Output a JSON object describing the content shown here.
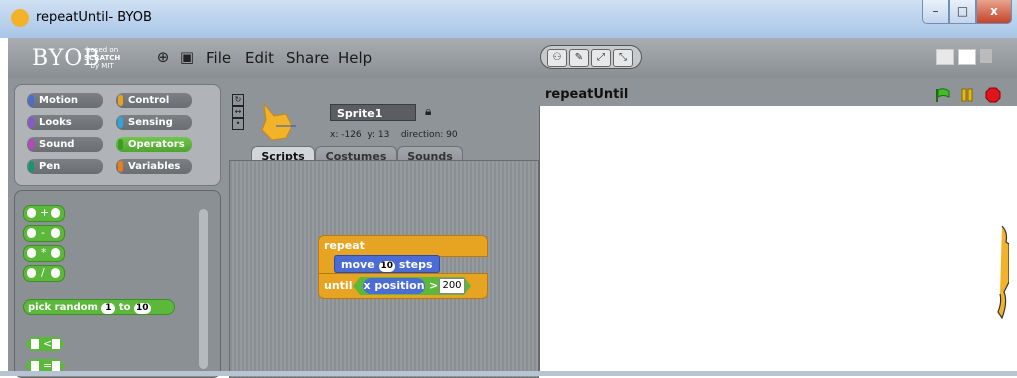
{
  "window": {
    "title": "repeatUntil- BYOB",
    "minimize_glyph": "–",
    "maximize_glyph": "□",
    "close_glyph": "x"
  },
  "menubar": {
    "logo": "BYOB",
    "logo_sub_line1": "based on",
    "logo_sub_line2": "SCRATCH",
    "logo_sub_line3": "by MIT",
    "language_icon": "globe-icon",
    "save_icon": "floppy-icon",
    "items": [
      "File",
      "Edit",
      "Share",
      "Help"
    ],
    "tools": [
      "person-icon",
      "wrench-icon",
      "grow-icon",
      "shrink-icon"
    ]
  },
  "categories": [
    {
      "label": "Motion",
      "color": "#4a6cd4"
    },
    {
      "label": "Control",
      "color": "#e6a422"
    },
    {
      "label": "Looks",
      "color": "#8a55d7"
    },
    {
      "label": "Sensing",
      "color": "#2ca5e2"
    },
    {
      "label": "Sound",
      "color": "#bb42c3"
    },
    {
      "label": "Operators",
      "color": "#5cb83a",
      "active": true
    },
    {
      "label": "Pen",
      "color": "#0e9a6c"
    },
    {
      "label": "Variables",
      "color": "#ee7d16"
    }
  ],
  "palette": {
    "operators": [
      "+",
      "-",
      "*",
      "/"
    ],
    "pick_random": {
      "label_start": "pick random",
      "from": "1",
      "to_label": "to",
      "to": "10"
    },
    "comparisons": [
      "<",
      "="
    ]
  },
  "sprite": {
    "name": "Sprite1",
    "coords": "x: -126  y: 13    direction: 90",
    "tabs": [
      "Scripts",
      "Costumes",
      "Sounds"
    ],
    "active_tab": "Scripts"
  },
  "script": {
    "repeat_label": "repeat",
    "move_label": "move",
    "move_steps": "10",
    "steps_label": "steps",
    "until_label": "until",
    "reporter": "x position",
    "operator": ">",
    "threshold": "200"
  },
  "stage": {
    "title": "repeatUntil"
  },
  "colors": {
    "control": "#e6a422",
    "motion": "#4a6cd4",
    "operators": "#5cb83a"
  }
}
